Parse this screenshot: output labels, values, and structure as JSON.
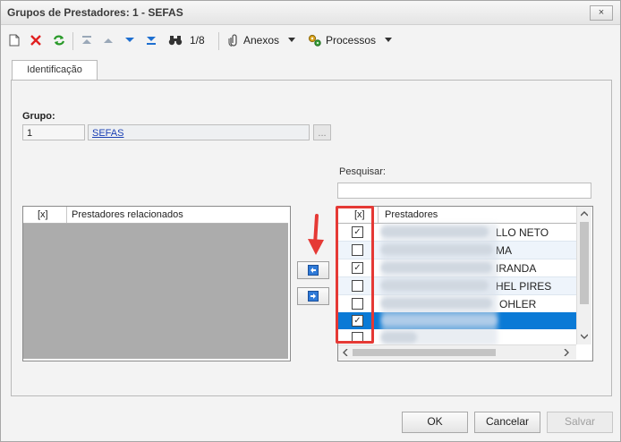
{
  "window": {
    "title": "Grupos de Prestadores: 1 - SEFAS",
    "close_label": "×"
  },
  "toolbar": {
    "record_counter": "1/8",
    "attachments_label": "Anexos",
    "processes_label": "Processos"
  },
  "tab": {
    "label": "Identificação"
  },
  "group": {
    "label": "Grupo:",
    "code": "1",
    "name": "SEFAS",
    "lookup_label": "..."
  },
  "search": {
    "label": "Pesquisar:",
    "value": ""
  },
  "left_grid": {
    "col_check": "[x]",
    "col_name": "Prestadores relacionados"
  },
  "right_grid": {
    "col_check": "[x]",
    "col_name": "Prestadores",
    "rows": [
      {
        "checked": "✓",
        "name": "LLO NETO",
        "selected": false
      },
      {
        "checked": "",
        "name": "MA",
        "selected": false
      },
      {
        "checked": "✓",
        "name": "IRANDA",
        "selected": false
      },
      {
        "checked": "",
        "name": "HEL PIRES",
        "selected": false
      },
      {
        "checked": "",
        "name": "OHLER",
        "selected": false
      },
      {
        "checked": "✓",
        "name": "",
        "selected": true
      },
      {
        "checked": "",
        "name": "",
        "selected": false
      }
    ]
  },
  "footer": {
    "ok_label": "OK",
    "cancel_label": "Cancelar",
    "save_label": "Salvar"
  },
  "colors": {
    "selection": "#0a7ad6",
    "highlight_box": "#e53935",
    "annotation_arrow": "#e53935"
  }
}
